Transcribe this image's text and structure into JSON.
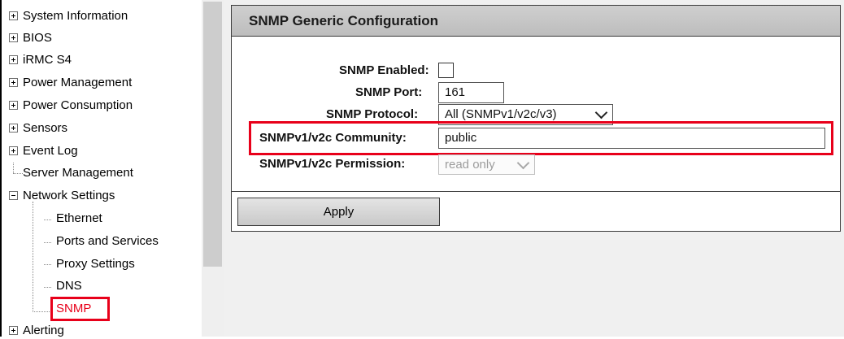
{
  "nav": {
    "items": [
      {
        "label": "System Information",
        "toggle": "plus"
      },
      {
        "label": "BIOS",
        "toggle": "plus"
      },
      {
        "label": "iRMC S4",
        "toggle": "plus"
      },
      {
        "label": "Power Management",
        "toggle": "plus"
      },
      {
        "label": "Power Consumption",
        "toggle": "plus"
      },
      {
        "label": "Sensors",
        "toggle": "plus"
      },
      {
        "label": "Event Log",
        "toggle": "plus"
      },
      {
        "label": "Server Management",
        "toggle": "none"
      },
      {
        "label": "Network Settings",
        "toggle": "minus"
      },
      {
        "label": "Ethernet",
        "toggle": "child"
      },
      {
        "label": "Ports and Services",
        "toggle": "child"
      },
      {
        "label": "Proxy Settings",
        "toggle": "child"
      },
      {
        "label": "DNS",
        "toggle": "child"
      },
      {
        "label": "SNMP",
        "toggle": "child",
        "selected": true
      },
      {
        "label": "Alerting",
        "toggle": "plus"
      }
    ]
  },
  "panel": {
    "title": "SNMP Generic Configuration",
    "fields": {
      "snmp_enabled": {
        "label": "SNMP Enabled:",
        "checked": false
      },
      "snmp_port": {
        "label": "SNMP Port:",
        "value": "161"
      },
      "snmp_protocol": {
        "label": "SNMP Protocol:",
        "value": "All (SNMPv1/v2c/v3)"
      },
      "community": {
        "label": "SNMPv1/v2c Community:",
        "value": "public"
      },
      "permission": {
        "label": "SNMPv1/v2c Permission:",
        "value": "read only",
        "disabled": true
      }
    },
    "apply_label": "Apply"
  },
  "colors": {
    "highlight": "#e8001a",
    "header_bg": "#c6c6c6",
    "main_bg": "#f0f0f0"
  }
}
